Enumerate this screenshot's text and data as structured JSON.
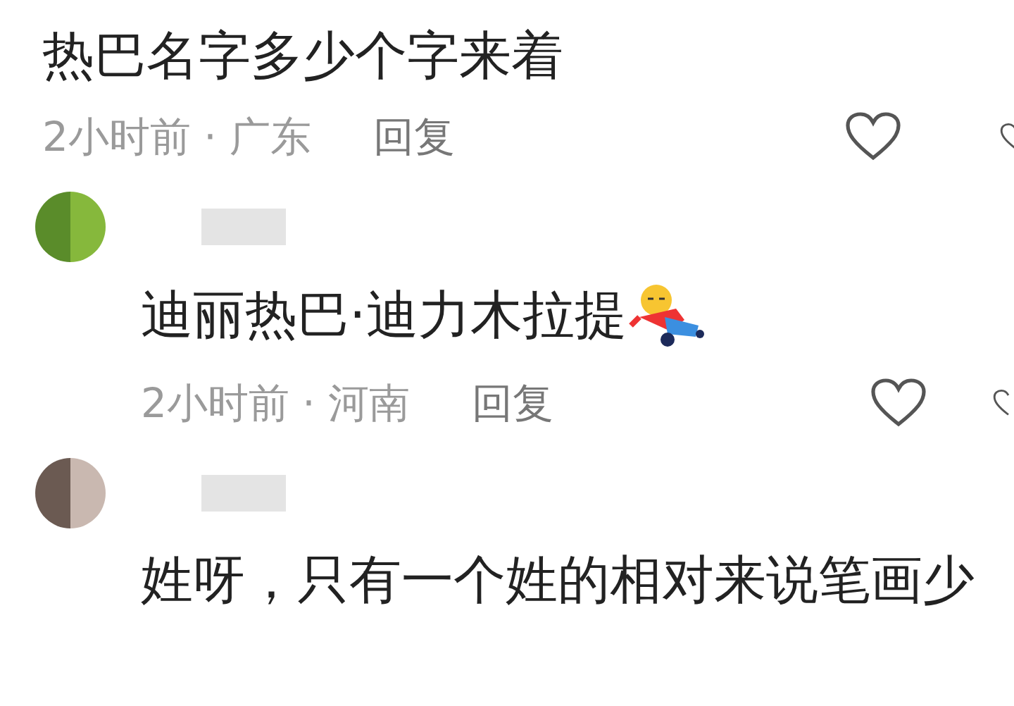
{
  "comments": [
    {
      "text": "热巴名字多少个字来着",
      "time": "2小时前 · 广东",
      "reply_label": "回复",
      "children": [
        {
          "text": "迪丽热巴·迪力木拉提",
          "emoji": true,
          "time": "2小时前 · 河南",
          "reply_label": "回复"
        },
        {
          "text": "姓呀，只有一个姓的相对来说笔画少",
          "emoji": false
        }
      ]
    }
  ]
}
